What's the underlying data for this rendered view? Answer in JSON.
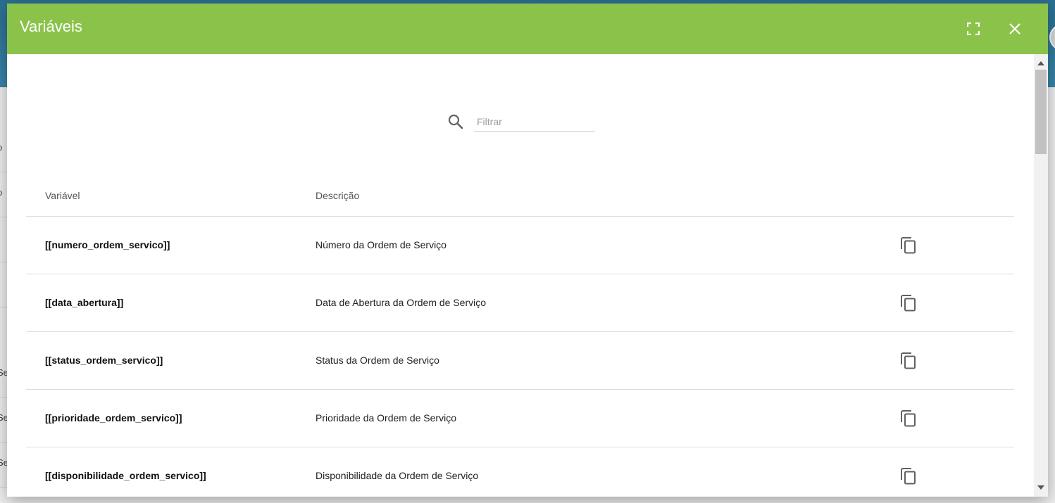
{
  "modal": {
    "title": "Variáveis",
    "fullscreen_icon": "fullscreen-icon",
    "close_icon": "close-icon"
  },
  "filter": {
    "icon": "search-icon",
    "placeholder": "Filtrar",
    "value": ""
  },
  "table": {
    "headers": {
      "variable": "Variável",
      "description": "Descrição"
    },
    "rows": [
      {
        "variable": "[[numero_ordem_servico]]",
        "description": "Número da Ordem de Serviço"
      },
      {
        "variable": "[[data_abertura]]",
        "description": "Data de Abertura da Ordem de Serviço"
      },
      {
        "variable": "[[status_ordem_servico]]",
        "description": "Status da Ordem de Serviço"
      },
      {
        "variable": "[[prioridade_ordem_servico]]",
        "description": "Prioridade da Ordem de Serviço"
      },
      {
        "variable": "[[disponibilidade_ordem_servico]]",
        "description": "Disponibilidade da Ordem de Serviço"
      }
    ],
    "copy_icon": "copy-icon"
  },
  "background": {
    "row_fragments": [
      "o",
      "o",
      "",
      "-",
      "Se",
      "Se",
      "Se"
    ]
  },
  "colors": {
    "header": "#8bc34a",
    "background_bar": "#2a6f91"
  }
}
